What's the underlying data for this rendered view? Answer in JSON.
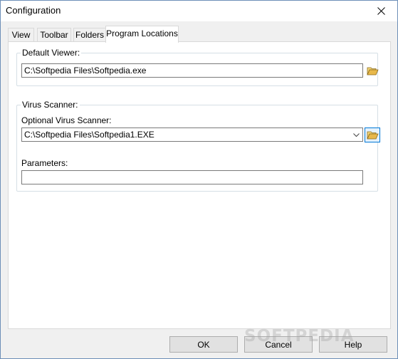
{
  "window": {
    "title": "Configuration"
  },
  "tabs": [
    {
      "label": "View"
    },
    {
      "label": "Toolbar"
    },
    {
      "label": "Folders"
    },
    {
      "label": "Program Locations",
      "active": true
    }
  ],
  "default_viewer": {
    "group_label": "Default Viewer:",
    "path": "C:\\Softpedia Files\\Softpedia.exe",
    "browse_icon": "open-folder-icon"
  },
  "virus_scanner": {
    "group_label": "Virus Scanner:",
    "optional_label": "Optional Virus Scanner:",
    "path": "C:\\Softpedia Files\\Softpedia1.EXE",
    "browse_icon": "open-folder-icon",
    "parameters_label": "Parameters:",
    "parameters_value": ""
  },
  "buttons": {
    "ok": "OK",
    "cancel": "Cancel",
    "help": "Help"
  },
  "watermark": "SOFTPEDIA",
  "colors": {
    "accent": "#0078d7",
    "folder": "#e8b84a"
  }
}
